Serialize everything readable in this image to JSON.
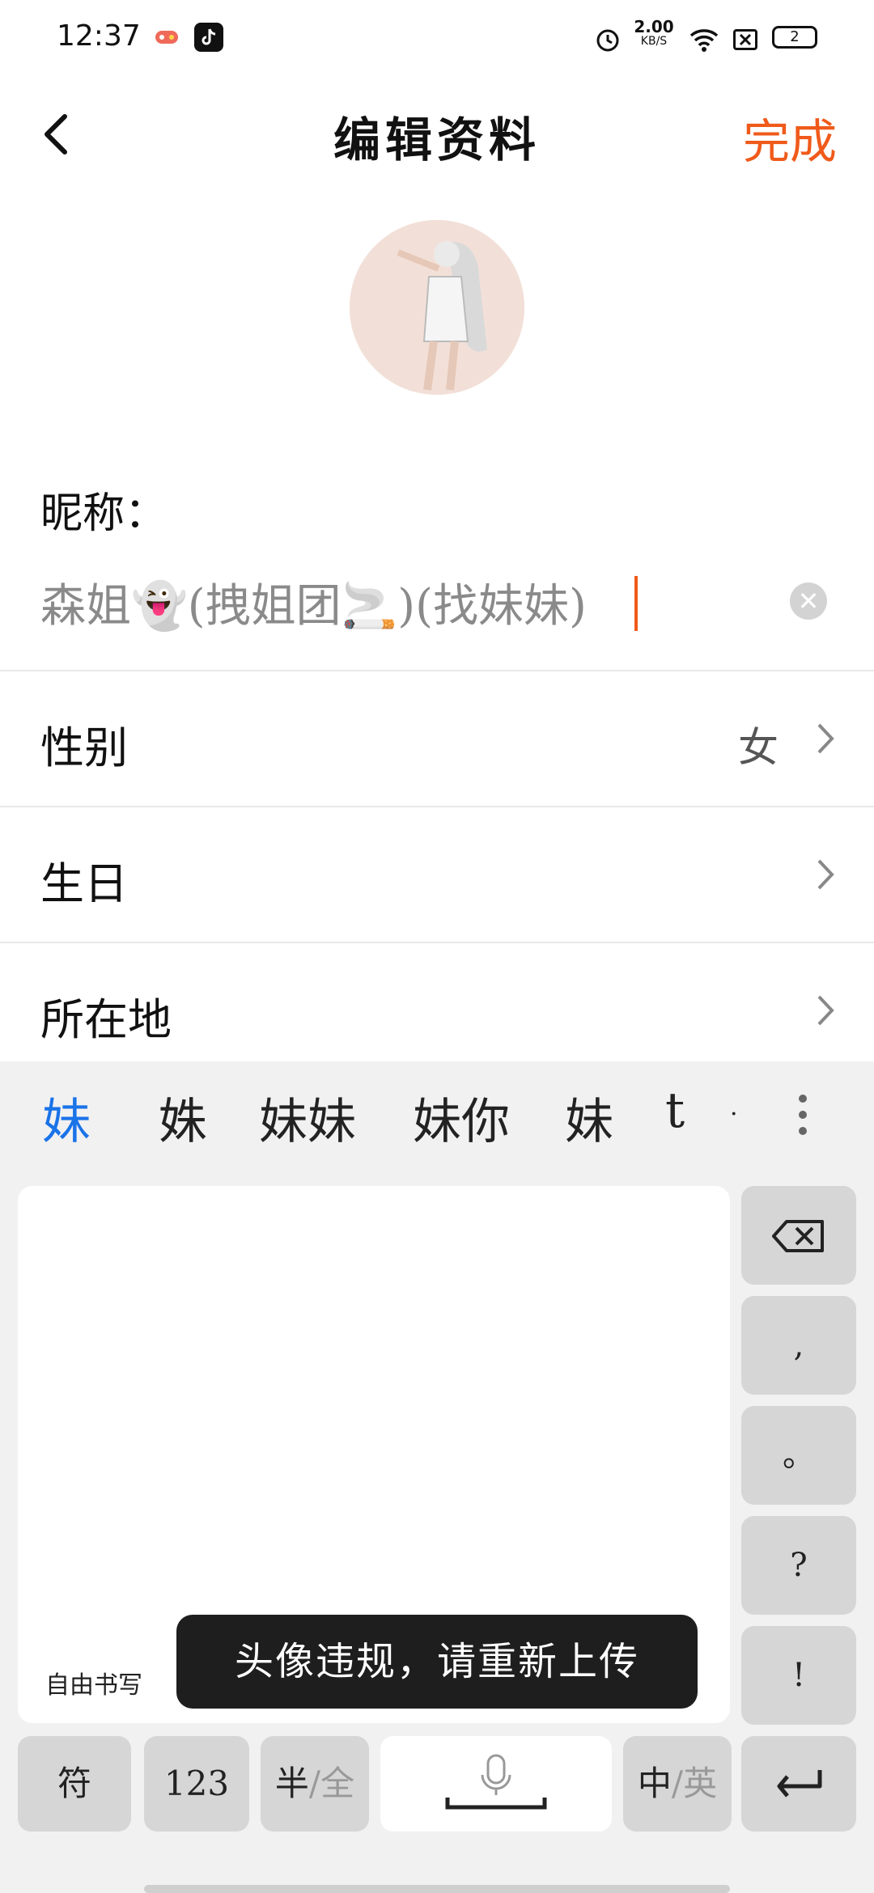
{
  "status_bar": {
    "time": "12:37",
    "net_speed_value": "2.00",
    "net_speed_unit": "KB/S",
    "battery": "2"
  },
  "header": {
    "title": "编辑资料",
    "done_label": "完成"
  },
  "profile": {
    "nickname_label": "昵称：",
    "nickname_value": "森姐👻(拽姐团🚬)(找妹妹)",
    "rows": [
      {
        "label": "性别",
        "value": "女"
      },
      {
        "label": "生日",
        "value": ""
      },
      {
        "label": "所在地",
        "value": ""
      }
    ]
  },
  "keyboard": {
    "candidates": [
      "妹",
      "姝",
      "妹妹",
      "妹你",
      "妹",
      "t",
      "·"
    ],
    "handwriting_label": "自由书写",
    "side_keys": [
      ",",
      "。",
      "?",
      "!"
    ],
    "bottom_keys": {
      "symbols": "符",
      "numbers": "123",
      "half_full_a": "半",
      "half_full_b": "/全",
      "lang_a": "中",
      "lang_b": "/英"
    }
  },
  "toast": {
    "message": "头像违规，请重新上传"
  },
  "colors": {
    "accent": "#f05a1a",
    "candidate_active": "#1a73e8"
  },
  "icons": [
    "back-arrow-icon",
    "clear-icon",
    "chevron-right-icon",
    "more-icon",
    "backspace-icon",
    "microphone-icon",
    "enter-icon",
    "alarm-icon",
    "wifi-icon"
  ]
}
